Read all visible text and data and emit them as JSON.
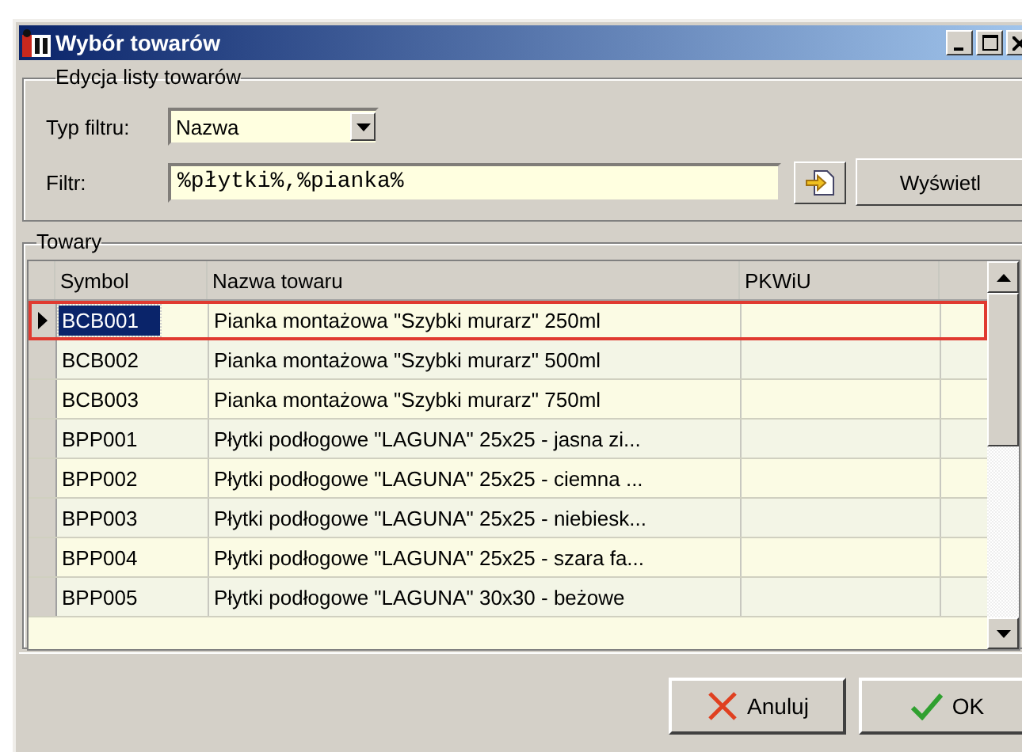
{
  "window": {
    "title": "Wybór towarów"
  },
  "edit_group": {
    "title": "Edycja listy towarów",
    "filter_type": {
      "label": "Typ filtru:",
      "value": "Nazwa"
    },
    "filter": {
      "label": "Filtr:",
      "value": "%płytki%,%pianka%"
    },
    "show_button": "Wyświetl"
  },
  "goods_group": {
    "title": "Towary",
    "columns": [
      "Symbol",
      "Nazwa towaru",
      "PKWiU"
    ],
    "rows": [
      {
        "symbol": "BCB001",
        "name": "Pianka montażowa \"Szybki murarz\" 250ml",
        "selected": true
      },
      {
        "symbol": "BCB002",
        "name": "Pianka montażowa \"Szybki murarz\" 500ml",
        "selected": false
      },
      {
        "symbol": "BCB003",
        "name": "Pianka montażowa \"Szybki murarz\" 750ml",
        "selected": false
      },
      {
        "symbol": "BPP001",
        "name": "Płytki podłogowe \"LAGUNA\" 25x25 - jasna zi...",
        "selected": false
      },
      {
        "symbol": "BPP002",
        "name": "Płytki podłogowe \"LAGUNA\" 25x25 - ciemna ...",
        "selected": false
      },
      {
        "symbol": "BPP003",
        "name": "Płytki podłogowe \"LAGUNA\" 25x25 - niebiesk...",
        "selected": false
      },
      {
        "symbol": "BPP004",
        "name": "Płytki podłogowe \"LAGUNA\" 25x25 - szara fa...",
        "selected": false
      },
      {
        "symbol": "BPP005",
        "name": "Płytki podłogowe \"LAGUNA\" 30x30 - beżowe",
        "selected": false
      }
    ]
  },
  "buttons": [
    {
      "kind": "cancel",
      "label": "Anuluj"
    },
    {
      "kind": "ok",
      "label": "OK"
    }
  ]
}
